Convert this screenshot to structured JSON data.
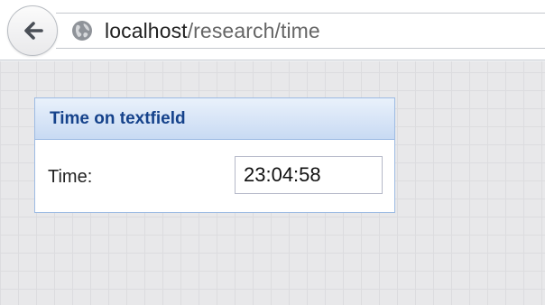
{
  "browser": {
    "url_host": "localhost",
    "url_path": "/research/time"
  },
  "icons": {
    "back": "back-arrow-icon",
    "site": "globe-icon"
  },
  "panel": {
    "title": "Time on textfield",
    "time_label": "Time:",
    "time_value": "23:04:58"
  },
  "colors": {
    "panel_title": "#15428b",
    "panel_border": "#9dbbe3",
    "header_gradient_top": "#e9f1fb",
    "header_gradient_bottom": "#c8daf3"
  }
}
